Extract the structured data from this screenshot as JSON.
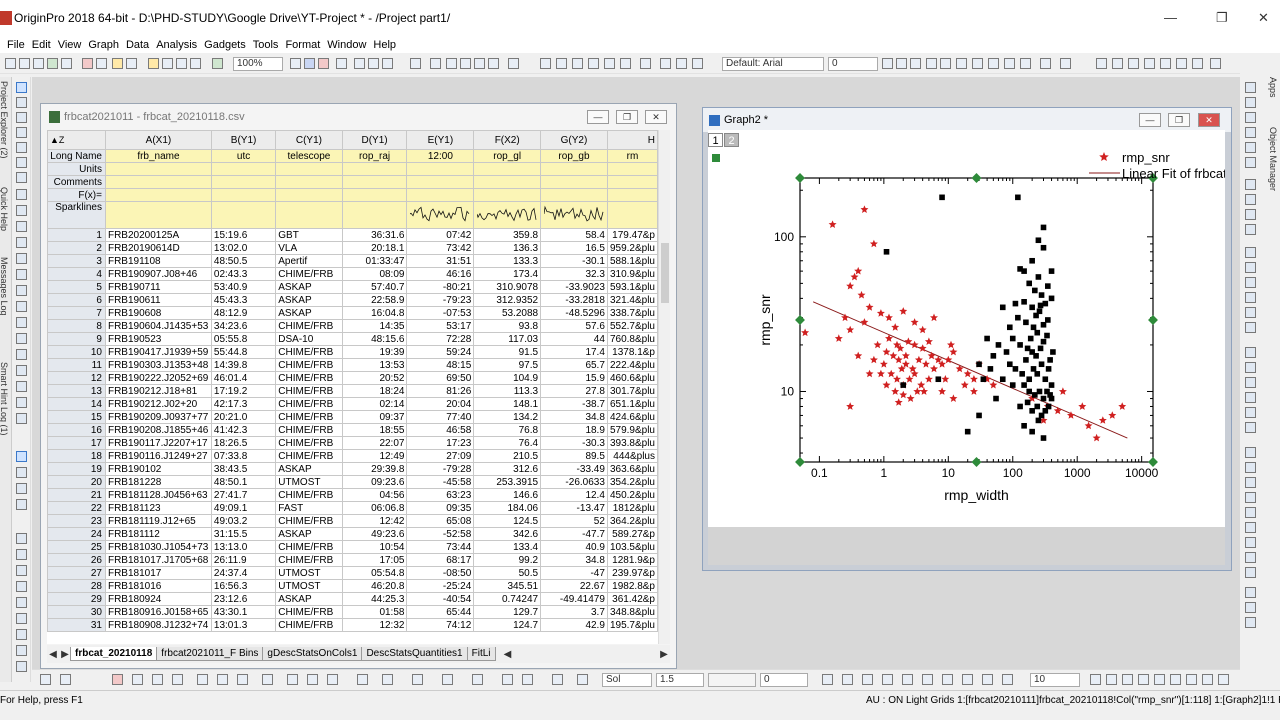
{
  "app": {
    "title": "OriginPro 2018 64-bit - D:\\PHD-STUDY\\Google Drive\\YT-Project * - /Project part1/",
    "minimize": "—",
    "maximize": "❐",
    "close": "✕"
  },
  "menu": [
    "File",
    "Edit",
    "View",
    "Graph",
    "Data",
    "Analysis",
    "Gadgets",
    "Tools",
    "Format",
    "Window",
    "Help"
  ],
  "toolbar": {
    "zoom": "100%",
    "font": "Default: Arial",
    "font_size": "0",
    "bottom_size": "10",
    "line_style": "Sol",
    "line_width": "1.5",
    "bottom_zero": "0"
  },
  "side_labels": {
    "left": [
      "Project Explorer (2)",
      "Quick Help",
      "Messages Log",
      "Smart Hint Log (1)"
    ],
    "right": [
      "Apps",
      "Object Manager"
    ]
  },
  "workbook": {
    "title": "frbcat2021011 - frbcat_20210118.csv",
    "columns": [
      "A(X1)",
      "B(Y1)",
      "C(Y1)",
      "D(Y1)",
      "E(Y1)",
      "F(X2)",
      "G(Y2)",
      "H"
    ],
    "meta": [
      {
        "label": "Long Name",
        "values": [
          "frb_name",
          "utc",
          "telescope",
          "rop_raj",
          "12:00",
          "rop_gl",
          "rop_gb",
          "rm"
        ]
      },
      {
        "label": "Units",
        "values": [
          "",
          "",
          "",
          "",
          "",
          "",
          "",
          ""
        ]
      },
      {
        "label": "Comments",
        "values": [
          "",
          "",
          "",
          "",
          "",
          "",
          "",
          ""
        ]
      },
      {
        "label": "F(x)=",
        "values": [
          "",
          "",
          "",
          "",
          "",
          "",
          "",
          ""
        ]
      }
    ],
    "sparklines_label": "Sparklines",
    "rows": [
      [
        "1",
        "FRB20200125A",
        "15:19.6",
        "GBT",
        "36:31.6",
        "07:42",
        "359.8",
        "58.4",
        "179.47&p"
      ],
      [
        "2",
        "FRB20190614D",
        "13:02.0",
        "VLA",
        "20:18.1",
        "73:42",
        "136.3",
        "16.5",
        "959.2&plu"
      ],
      [
        "3",
        "FRB191108",
        "48:50.5",
        "Apertif",
        "01:33:47",
        "31:51",
        "133.3",
        "-30.1",
        "588.1&plu"
      ],
      [
        "4",
        "FRB190907.J08+46",
        "02:43.3",
        "CHIME/FRB",
        "08:09",
        "46:16",
        "173.4",
        "32.3",
        "310.9&plu"
      ],
      [
        "5",
        "FRB190711",
        "53:40.9",
        "ASKAP",
        "57:40.7",
        "-80:21",
        "310.9078",
        "-33.9023",
        "593.1&plu"
      ],
      [
        "6",
        "FRB190611",
        "45:43.3",
        "ASKAP",
        "22:58.9",
        "-79:23",
        "312.9352",
        "-33.2818",
        "321.4&plu"
      ],
      [
        "7",
        "FRB190608",
        "48:12.9",
        "ASKAP",
        "16:04.8",
        "-07:53",
        "53.2088",
        "-48.5296",
        "338.7&plu"
      ],
      [
        "8",
        "FRB190604.J1435+53",
        "34:23.6",
        "CHIME/FRB",
        "14:35",
        "53:17",
        "93.8",
        "57.6",
        "552.7&plu"
      ],
      [
        "9",
        "FRB190523",
        "05:55.8",
        "DSA-10",
        "48:15.6",
        "72:28",
        "117.03",
        "44",
        "760.8&plu"
      ],
      [
        "10",
        "FRB190417.J1939+59",
        "55:44.8",
        "CHIME/FRB",
        "19:39",
        "59:24",
        "91.5",
        "17.4",
        "1378.1&p"
      ],
      [
        "11",
        "FRB190303.J1353+48",
        "14:39.8",
        "CHIME/FRB",
        "13:53",
        "48:15",
        "97.5",
        "65.7",
        "222.4&plu"
      ],
      [
        "12",
        "FRB190222.J2052+69",
        "46:01.4",
        "CHIME/FRB",
        "20:52",
        "69:50",
        "104.9",
        "15.9",
        "460.6&plu"
      ],
      [
        "13",
        "FRB190212.J18+81",
        "17:19.2",
        "CHIME/FRB",
        "18:24",
        "81:26",
        "113.3",
        "27.8",
        "301.7&plu"
      ],
      [
        "14",
        "FRB190212.J02+20",
        "42:17.3",
        "CHIME/FRB",
        "02:14",
        "20:04",
        "148.1",
        "-38.7",
        "651.1&plu"
      ],
      [
        "15",
        "FRB190209.J0937+77",
        "20:21.0",
        "CHIME/FRB",
        "09:37",
        "77:40",
        "134.2",
        "34.8",
        "424.6&plu"
      ],
      [
        "16",
        "FRB190208.J1855+46",
        "41:42.3",
        "CHIME/FRB",
        "18:55",
        "46:58",
        "76.8",
        "18.9",
        "579.9&plu"
      ],
      [
        "17",
        "FRB190117.J2207+17",
        "18:26.5",
        "CHIME/FRB",
        "22:07",
        "17:23",
        "76.4",
        "-30.3",
        "393.8&plu"
      ],
      [
        "18",
        "FRB190116.J1249+27",
        "07:33.8",
        "CHIME/FRB",
        "12:49",
        "27:09",
        "210.5",
        "89.5",
        "444&plus"
      ],
      [
        "19",
        "FRB190102",
        "38:43.5",
        "ASKAP",
        "29:39.8",
        "-79:28",
        "312.6",
        "-33.49",
        "363.6&plu"
      ],
      [
        "20",
        "FRB181228",
        "48:50.1",
        "UTMOST",
        "09:23.6",
        "-45:58",
        "253.3915",
        "-26.0633",
        "354.2&plu"
      ],
      [
        "21",
        "FRB181128.J0456+63",
        "27:41.7",
        "CHIME/FRB",
        "04:56",
        "63:23",
        "146.6",
        "12.4",
        "450.2&plu"
      ],
      [
        "22",
        "FRB181123",
        "49:09.1",
        "FAST",
        "06:06.8",
        "09:35",
        "184.06",
        "-13.47",
        "1812&plu"
      ],
      [
        "23",
        "FRB181119.J12+65",
        "49:03.2",
        "CHIME/FRB",
        "12:42",
        "65:08",
        "124.5",
        "52",
        "364.2&plu"
      ],
      [
        "24",
        "FRB181112",
        "31:15.5",
        "ASKAP",
        "49:23.6",
        "-52:58",
        "342.6",
        "-47.7",
        "589.27&p"
      ],
      [
        "25",
        "FRB181030.J1054+73",
        "13:13.0",
        "CHIME/FRB",
        "10:54",
        "73:44",
        "133.4",
        "40.9",
        "103.5&plu"
      ],
      [
        "26",
        "FRB181017.J1705+68",
        "26:11.9",
        "CHIME/FRB",
        "17:05",
        "68:17",
        "99.2",
        "34.8",
        "1281.9&p"
      ],
      [
        "27",
        "FRB181017",
        "24:37.4",
        "UTMOST",
        "05:54.8",
        "-08:50",
        "50.5",
        "-47",
        "239.97&p"
      ],
      [
        "28",
        "FRB181016",
        "16:56.3",
        "UTMOST",
        "46:20.8",
        "-25:24",
        "345.51",
        "22.67",
        "1982.8&p"
      ],
      [
        "29",
        "FRB180924",
        "23:12.6",
        "ASKAP",
        "44:25.3",
        "-40:54",
        "0.74247",
        "-49.41479",
        "361.42&p"
      ],
      [
        "30",
        "FRB180916.J0158+65",
        "43:30.1",
        "CHIME/FRB",
        "01:58",
        "65:44",
        "129.7",
        "3.7",
        "348.8&plu"
      ],
      [
        "31",
        "FRB180908.J1232+74",
        "13:01.3",
        "CHIME/FRB",
        "12:32",
        "74:12",
        "124.7",
        "42.9",
        "195.7&plu"
      ]
    ],
    "tabs": [
      "frbcat_20210118",
      "frbcat2021011_F Bins",
      "gDescStatsOnCols1",
      "DescStatsQuantities1",
      "FitLi"
    ]
  },
  "graph": {
    "title": "Graph2 *",
    "layers": [
      "1",
      "2"
    ],
    "legend": [
      "rmp_snr",
      "Linear Fit of frbcat"
    ]
  },
  "chart_data": {
    "type": "scatter",
    "xlabel": "rmp_width",
    "ylabel": "rmp_snr",
    "xscale": "log",
    "yscale": "log",
    "xlim": [
      0.05,
      15000
    ],
    "ylim": [
      3.5,
      240
    ],
    "xticks": [
      "0.1",
      "1",
      "10",
      "100",
      "1000",
      "10000"
    ],
    "yticks": [
      "10",
      "100"
    ],
    "series": [
      {
        "name": "rmp_snr",
        "marker": "star",
        "color": "#d02020",
        "points": [
          [
            0.5,
            150
          ],
          [
            0.16,
            120
          ],
          [
            0.7,
            90
          ],
          [
            0.4,
            60
          ],
          [
            0.35,
            55
          ],
          [
            0.3,
            48
          ],
          [
            0.45,
            42
          ],
          [
            0.6,
            35
          ],
          [
            0.25,
            30
          ],
          [
            0.2,
            22
          ],
          [
            0.3,
            25
          ],
          [
            0.5,
            28
          ],
          [
            0.9,
            32
          ],
          [
            1.2,
            30
          ],
          [
            1.5,
            26
          ],
          [
            2,
            33
          ],
          [
            3,
            28
          ],
          [
            4,
            25
          ],
          [
            6,
            30
          ],
          [
            0.8,
            20
          ],
          [
            1.1,
            18
          ],
          [
            1.4,
            17
          ],
          [
            1.7,
            16
          ],
          [
            2.2,
            15
          ],
          [
            2.8,
            14
          ],
          [
            3.5,
            16
          ],
          [
            4.5,
            15
          ],
          [
            5.5,
            17
          ],
          [
            7,
            16
          ],
          [
            1,
            15
          ],
          [
            1.3,
            13
          ],
          [
            1.6,
            12
          ],
          [
            2,
            11
          ],
          [
            2.5,
            12
          ],
          [
            3,
            13
          ],
          [
            3.8,
            11
          ],
          [
            4.2,
            10
          ],
          [
            5,
            12
          ],
          [
            6,
            14
          ],
          [
            8,
            15
          ],
          [
            10,
            16
          ],
          [
            12,
            18
          ],
          [
            15,
            14
          ],
          [
            20,
            13
          ],
          [
            25,
            12
          ],
          [
            30,
            15
          ],
          [
            40,
            12
          ],
          [
            50,
            11
          ],
          [
            1.8,
            19
          ],
          [
            2.4,
            21
          ],
          [
            0.9,
            13
          ],
          [
            1.1,
            11
          ],
          [
            1.5,
            10
          ],
          [
            2,
            9.5
          ],
          [
            2.6,
            9
          ],
          [
            3.3,
            10
          ],
          [
            0.6,
            13
          ],
          [
            0.4,
            17
          ],
          [
            0.7,
            16
          ],
          [
            8,
            10
          ],
          [
            9,
            12
          ],
          [
            12,
            9
          ],
          [
            18,
            11
          ],
          [
            25,
            10
          ],
          [
            1.9,
            14
          ],
          [
            2.2,
            17
          ],
          [
            4,
            19
          ],
          [
            5,
            21
          ],
          [
            3,
            20
          ],
          [
            1.2,
            22
          ],
          [
            1.6,
            20
          ],
          [
            200,
            9
          ],
          [
            350,
            8
          ],
          [
            500,
            7.5
          ],
          [
            800,
            7
          ],
          [
            1500,
            6
          ],
          [
            2500,
            6.5
          ],
          [
            3500,
            7
          ],
          [
            5000,
            8
          ],
          [
            600,
            10
          ],
          [
            1200,
            8
          ],
          [
            300,
            6.5
          ],
          [
            2000,
            5
          ],
          [
            0.06,
            24
          ],
          [
            0.3,
            8
          ],
          [
            11,
            20
          ],
          [
            1.7,
            8.5
          ]
        ]
      },
      {
        "name": "",
        "marker": "square",
        "color": "#000000",
        "points": [
          [
            8,
            180
          ],
          [
            1.1,
            80
          ],
          [
            120,
            180
          ],
          [
            300,
            115
          ],
          [
            250,
            95
          ],
          [
            200,
            70
          ],
          [
            300,
            85
          ],
          [
            150,
            60
          ],
          [
            250,
            55
          ],
          [
            400,
            60
          ],
          [
            180,
            50
          ],
          [
            220,
            45
          ],
          [
            280,
            42
          ],
          [
            350,
            48
          ],
          [
            150,
            38
          ],
          [
            200,
            35
          ],
          [
            260,
            33
          ],
          [
            320,
            37
          ],
          [
            400,
            40
          ],
          [
            120,
            30
          ],
          [
            160,
            28
          ],
          [
            210,
            26
          ],
          [
            240,
            24
          ],
          [
            300,
            27
          ],
          [
            350,
            29
          ],
          [
            100,
            22
          ],
          [
            130,
            20
          ],
          [
            170,
            19
          ],
          [
            200,
            18
          ],
          [
            230,
            17
          ],
          [
            270,
            19
          ],
          [
            300,
            21
          ],
          [
            340,
            23
          ],
          [
            380,
            16
          ],
          [
            420,
            18
          ],
          [
            90,
            15
          ],
          [
            110,
            14
          ],
          [
            140,
            13
          ],
          [
            180,
            12
          ],
          [
            210,
            14
          ],
          [
            240,
            13
          ],
          [
            280,
            15
          ],
          [
            320,
            12
          ],
          [
            360,
            14
          ],
          [
            400,
            11
          ],
          [
            150,
            11
          ],
          [
            180,
            10
          ],
          [
            220,
            9.5
          ],
          [
            260,
            10
          ],
          [
            300,
            9
          ],
          [
            340,
            10
          ],
          [
            380,
            9.5
          ],
          [
            130,
            8
          ],
          [
            170,
            8.5
          ],
          [
            200,
            7.5
          ],
          [
            240,
            8
          ],
          [
            280,
            7
          ],
          [
            320,
            7.5
          ],
          [
            360,
            8
          ],
          [
            400,
            9
          ],
          [
            60,
            20
          ],
          [
            80,
            18
          ],
          [
            50,
            17
          ],
          [
            45,
            14
          ],
          [
            70,
            12
          ],
          [
            100,
            11
          ],
          [
            160,
            16
          ],
          [
            190,
            22
          ],
          [
            230,
            31
          ],
          [
            270,
            36
          ],
          [
            130,
            62
          ],
          [
            90,
            26
          ],
          [
            110,
            37
          ],
          [
            70,
            35
          ],
          [
            40,
            22
          ],
          [
            35,
            12
          ],
          [
            30,
            15
          ],
          [
            20,
            5.5
          ],
          [
            2,
            11
          ],
          [
            7,
            12
          ],
          [
            150,
            6
          ],
          [
            250,
            6.5
          ],
          [
            300,
            5
          ],
          [
            200,
            5.5
          ],
          [
            30,
            7
          ],
          [
            55,
            9
          ]
        ]
      }
    ],
    "fit_line": {
      "name": "Linear Fit of frbcat",
      "x": [
        0.08,
        6000
      ],
      "y": [
        38,
        5
      ]
    }
  },
  "status": {
    "left": "For Help, press F1",
    "right": "AU : ON  Light Grids  1:[frbcat20210111]frbcat_20210118!Col(\"rmp_snr\")[1:118]  1:[Graph2]1!1  Radian"
  }
}
